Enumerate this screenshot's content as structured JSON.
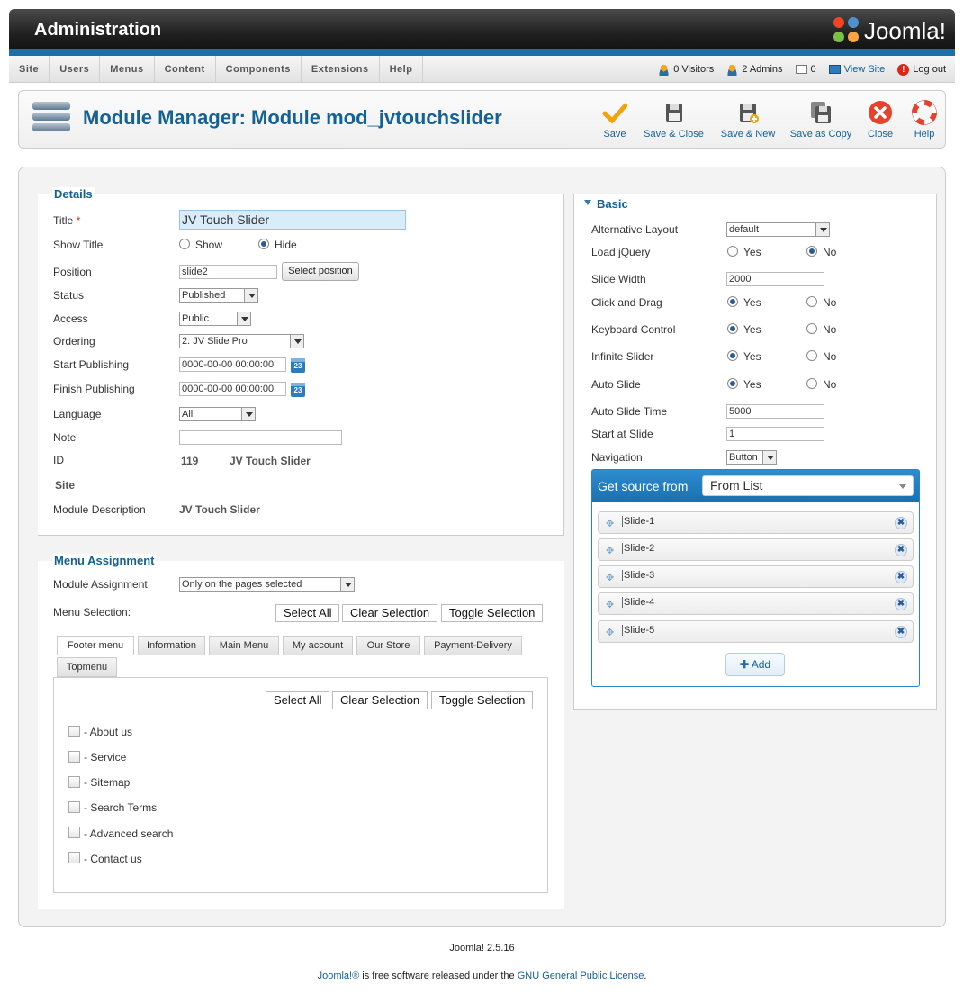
{
  "header": {
    "title": "Administration",
    "logo_text": "Joomla!"
  },
  "menu": {
    "items": [
      "Site",
      "Users",
      "Menus",
      "Content",
      "Components",
      "Extensions",
      "Help"
    ]
  },
  "status": {
    "visitors": "0 Visitors",
    "admins": "2 Admins",
    "messages": "0",
    "view_site": "View Site",
    "logout": "Log out"
  },
  "toolbar": {
    "page_title": "Module Manager: Module mod_jvtouchslider",
    "save": "Save",
    "save_close": "Save & Close",
    "save_new": "Save & New",
    "save_copy": "Save as Copy",
    "close": "Close",
    "help": "Help"
  },
  "details": {
    "legend": "Details",
    "title_label": "Title",
    "required_mark": "*",
    "title_value": "JV Touch Slider",
    "show_title_label": "Show Title",
    "show": "Show",
    "hide": "Hide",
    "position_label": "Position",
    "position_value": "slide2",
    "select_position": "Select position",
    "status_label": "Status",
    "status_value": "Published",
    "access_label": "Access",
    "access_value": "Public",
    "ordering_label": "Ordering",
    "ordering_value": "2. JV Slide Pro",
    "start_label": "Start Publishing",
    "start_value": "0000-00-00 00:00:00",
    "finish_label": "Finish Publishing",
    "finish_value": "0000-00-00 00:00:00",
    "cal_text": "23",
    "language_label": "Language",
    "language_value": "All",
    "note_label": "Note",
    "id_label": "ID",
    "id_value": "119",
    "id_name": "JV Touch Slider",
    "site_label": "Site",
    "desc_label": "Module Description",
    "desc_value": "JV Touch Slider"
  },
  "menu_assignment": {
    "legend": "Menu Assignment",
    "module_assignment_label": "Module Assignment",
    "module_assignment_value": "Only on the pages selected",
    "menu_selection_label": "Menu Selection:",
    "select_all": "Select All",
    "clear_selection": "Clear Selection",
    "toggle_selection": "Toggle Selection",
    "tabs": [
      "Footer menu",
      "Information",
      "Main Menu",
      "My account",
      "Our Store",
      "Payment-Delivery",
      "Topmenu"
    ],
    "items": [
      "- About us",
      "- Service",
      "- Sitemap",
      "- Search Terms",
      "- Advanced search",
      "- Contact us"
    ]
  },
  "basic": {
    "legend": "Basic",
    "alt_layout_label": "Alternative Layout",
    "alt_layout_value": "default",
    "load_jquery_label": "Load jQuery",
    "yes": "Yes",
    "no": "No",
    "slide_width_label": "Slide Width",
    "slide_width_value": "2000",
    "click_drag_label": "Click and Drag",
    "keyboard_label": "Keyboard Control",
    "infinite_label": "Infinite Slider",
    "auto_slide_label": "Auto Slide",
    "auto_slide_time_label": "Auto Slide Time",
    "auto_slide_time_value": "5000",
    "start_slide_label": "Start at Slide",
    "start_slide_value": "1",
    "navigation_label": "Navigation",
    "navigation_value": "Button",
    "source_label": "Get source from",
    "source_value": "From List",
    "slides": [
      "Slide-1",
      "Slide-2",
      "Slide-3",
      "Slide-4",
      "Slide-5"
    ],
    "add": "Add"
  },
  "footer": {
    "version": "Joomla! 2.5.16",
    "joomla_link": "Joomla!®",
    "license_text": " is free software released under the ",
    "license_link": "GNU General Public License",
    "period": "."
  }
}
